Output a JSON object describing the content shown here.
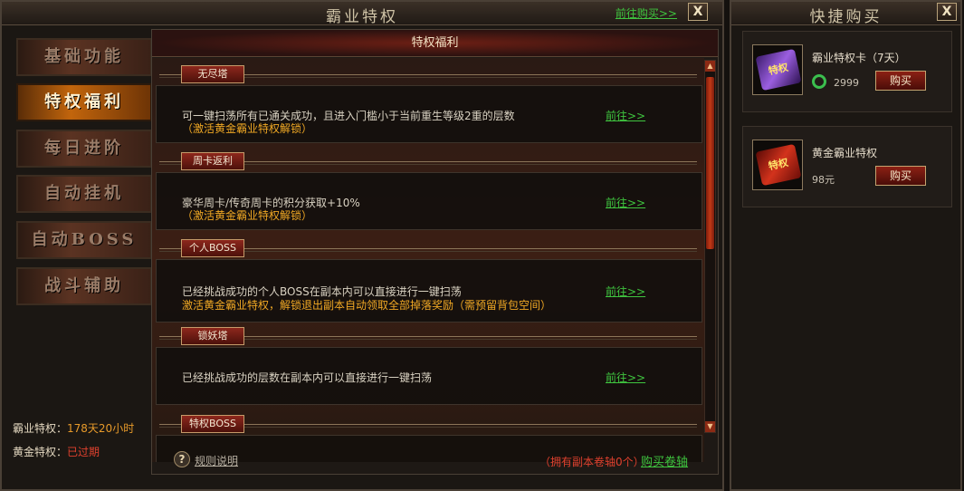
{
  "main_window": {
    "title": "霸业特权",
    "buy_link": "前往购买>>",
    "close_label": "X"
  },
  "sidebar": {
    "items": [
      {
        "label": "基础功能"
      },
      {
        "label": "特权福利",
        "active": true
      },
      {
        "label": "每日进阶"
      },
      {
        "label": "自动挂机"
      },
      {
        "label": "自动BOSS"
      },
      {
        "label": "战斗辅助"
      }
    ],
    "info": {
      "privilege_label": "霸业特权：",
      "privilege_value": "178天20小时",
      "gold_label": "黄金特权：",
      "gold_value": "已过期"
    }
  },
  "content": {
    "header": "特权福利",
    "sections": [
      {
        "tab": "无尽塔",
        "desc": "可一键扫荡所有已通关成功，且进入门槛小于当前重生等级2重的层数",
        "note": "（激活黄金霸业特权解锁）",
        "link": "前往>>"
      },
      {
        "tab": "周卡返利",
        "desc": "豪华周卡/传奇周卡的积分获取+10%",
        "note": "（激活黄金霸业特权解锁）",
        "link": "前往>>"
      },
      {
        "tab": "个人BOSS",
        "desc": "已经挑战成功的个人BOSS在副本内可以直接进行一键扫荡",
        "note": "激活黄金霸业特权，解锁退出副本自动领取全部掉落奖励（需预留背包空间）",
        "link": "前往>>"
      },
      {
        "tab": "锁妖塔",
        "desc": "已经挑战成功的层数在副本内可以直接进行一键扫荡",
        "note": "",
        "link": "前往>>"
      },
      {
        "tab": "特权BOSS"
      }
    ],
    "footer": {
      "help_icon": "?",
      "help_label": "规则说明",
      "scroll_count": "（拥有副本卷轴0个）",
      "buy_scroll": "购买卷轴"
    }
  },
  "quick_buy": {
    "title": "快捷购买",
    "close_label": "X",
    "items": [
      {
        "name": "霸业特权卡（7天）",
        "price": "2999",
        "currency_icon": "jade-icon",
        "button": "购买",
        "icon_text": "特权"
      },
      {
        "name": "黄金霸业特权",
        "price": "98元",
        "button": "购买",
        "icon_text": "特权"
      }
    ]
  },
  "colors": {
    "link_green": "#3fc43f",
    "note_orange": "#f0a824",
    "expired_red": "#e0412e",
    "time_orange": "#e79a2a",
    "active_tab": "#c2650c"
  }
}
